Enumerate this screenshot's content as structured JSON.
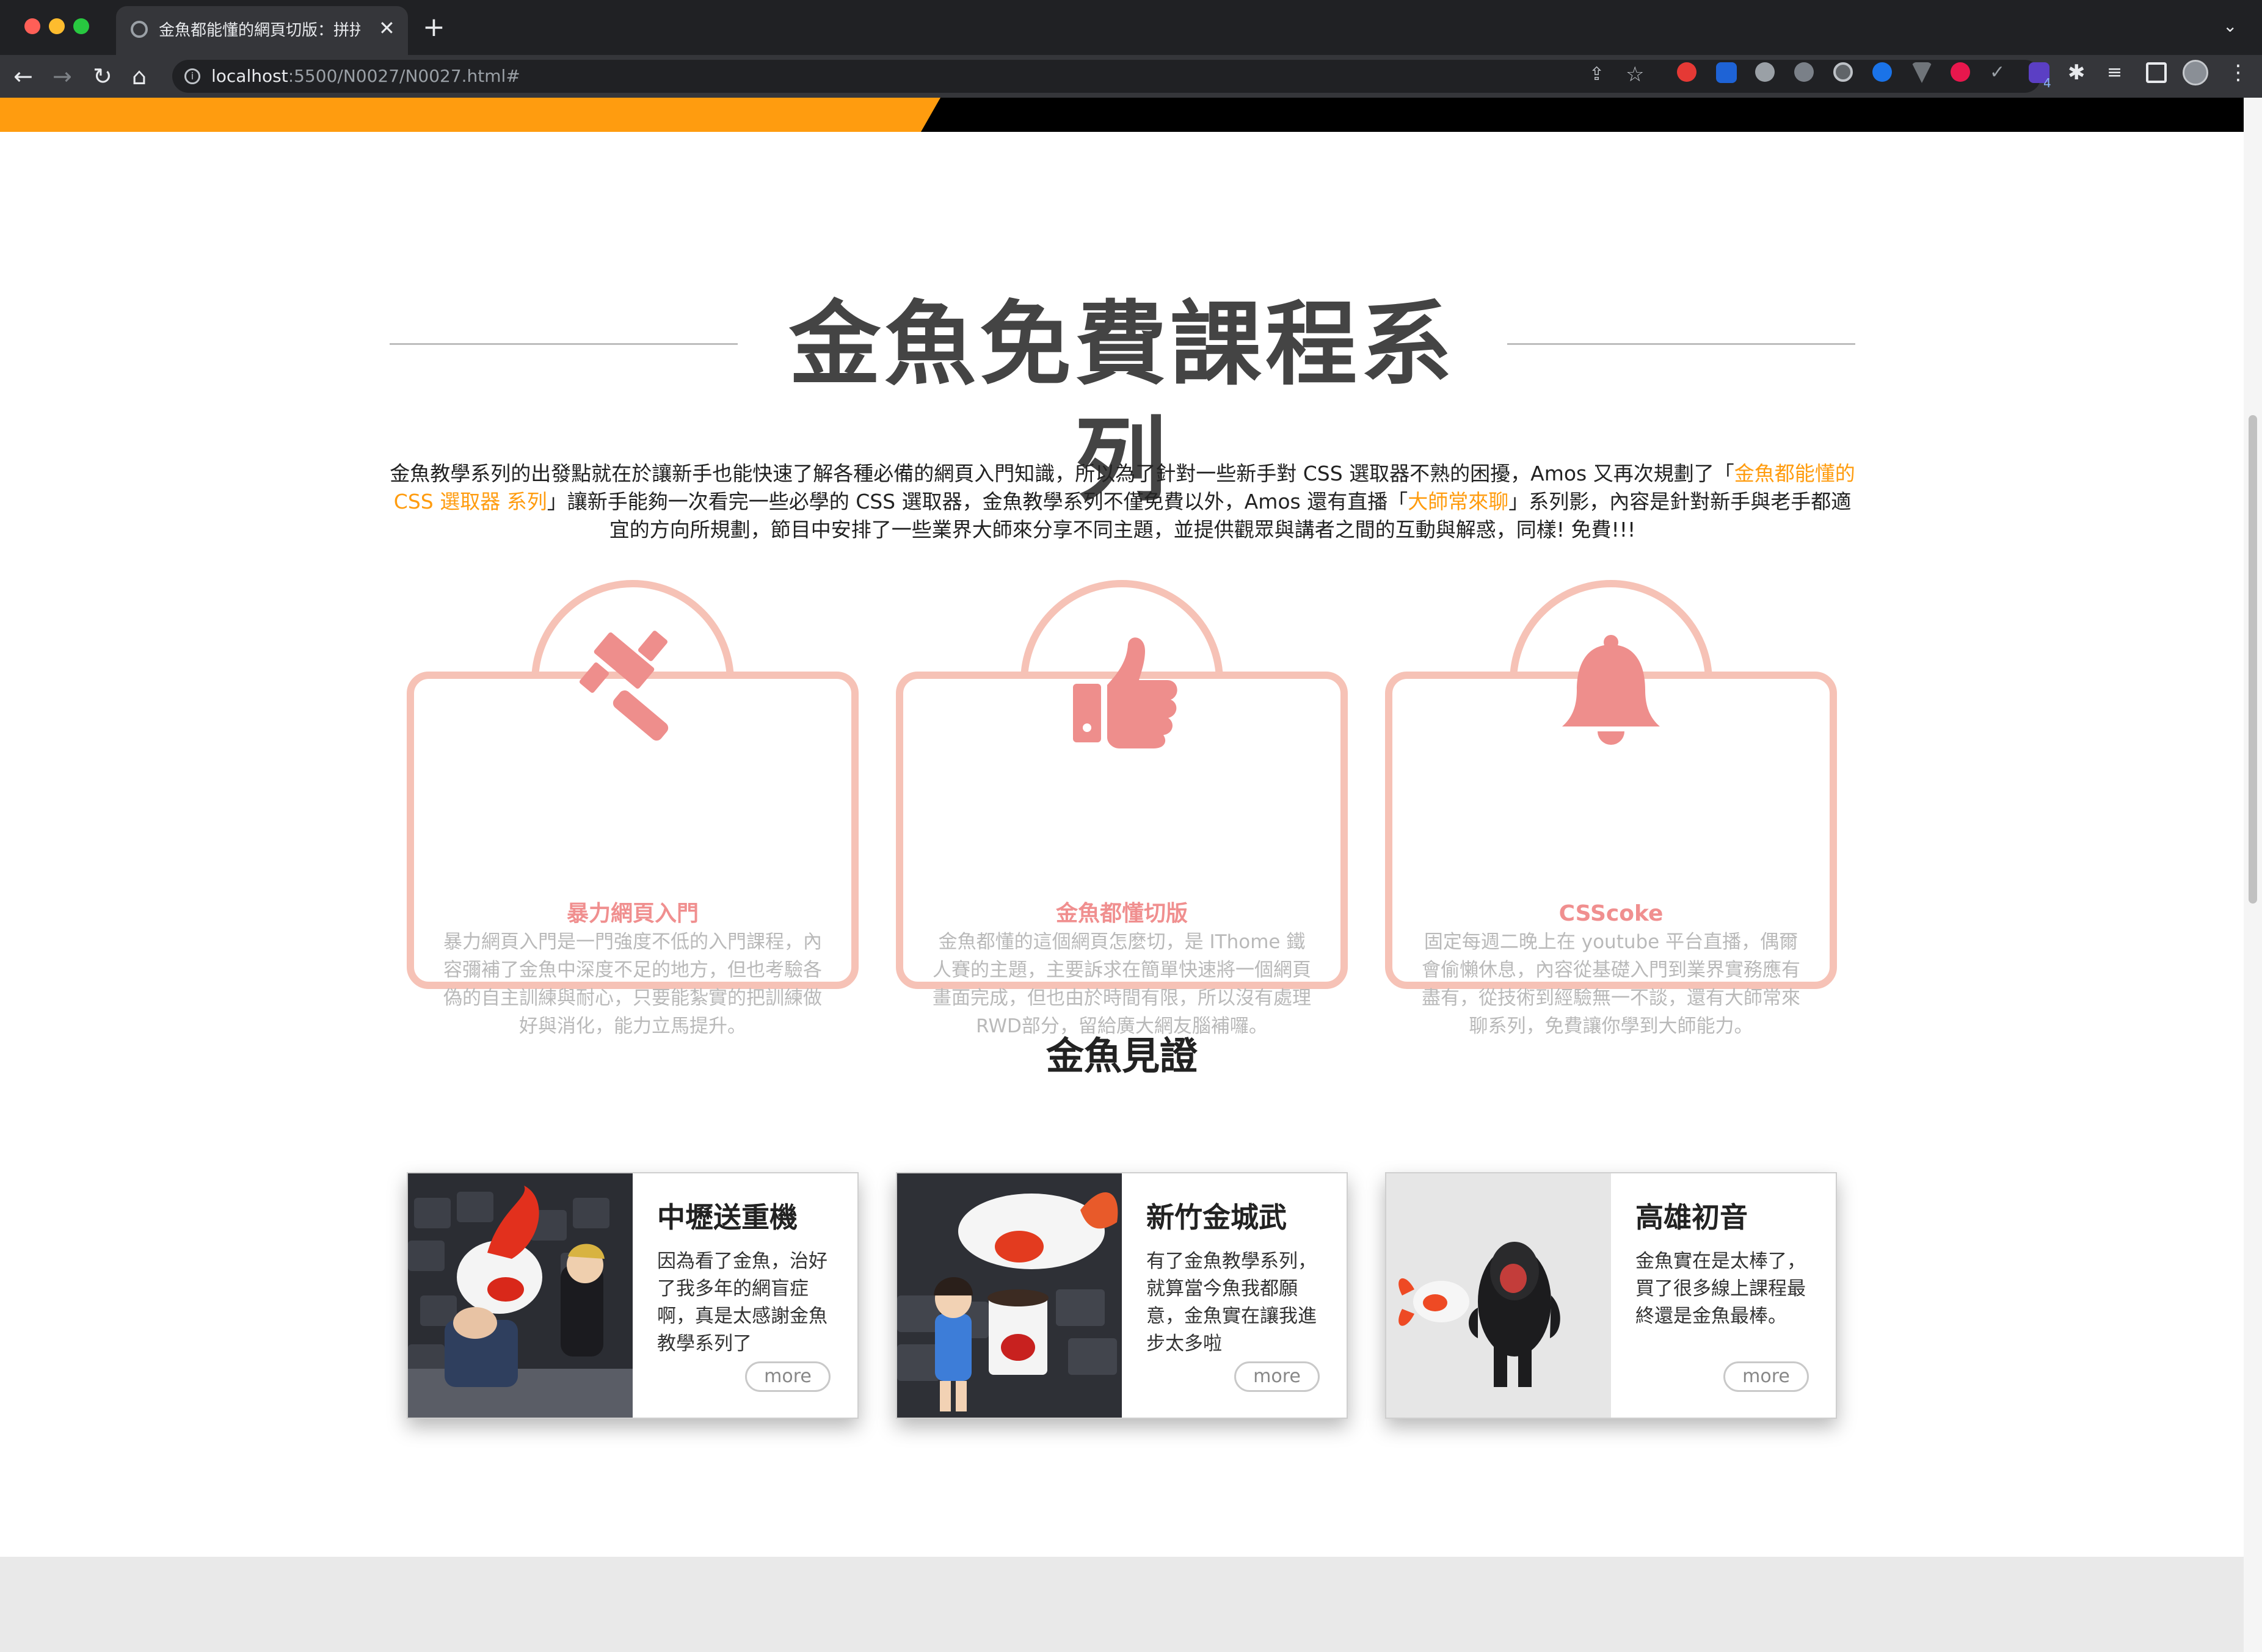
{
  "browser": {
    "tab_title": "金魚都能懂的網頁切版：拼拼版",
    "url_host": "localhost",
    "url_path": ":5500/N0027/N0027.html#",
    "extension_badge": "4"
  },
  "section": {
    "title": "金魚免費課程系列",
    "intro_part1": "金魚教學系列的出發點就在於讓新手也能快速了解各種必備的網頁入門知識，所以為了針對一些新手對 CSS 選取器不熟的困擾，Amos 又再次規劃了「",
    "intro_link1": "金魚都能懂的 CSS 選取器 系列",
    "intro_part2": "」讓新手能夠一次看完一些必學的 CSS 選取器，金魚教學系列不僅免費以外，Amos 還有直播「",
    "intro_link2": "大師常來聊",
    "intro_part3": "」系列影，內容是針對新手與老手都適宜的方向所規劃，節目中安排了一些業界大師來分享不同主題，並提供觀眾與講者之間的互動與解惑，同樣! 免費!!!"
  },
  "features": [
    {
      "icon": "gavel-icon",
      "title": "暴力網頁入門",
      "desc": "暴力網頁入門是一門強度不低的入門課程，內容彌補了金魚中深度不足的地方，但也考驗各偽的自主訓練與耐心，只要能紮實的把訓練做好與消化，能力立馬提升。"
    },
    {
      "icon": "thumbs-up-icon",
      "title": "金魚都懂切版",
      "desc": "金魚都懂的這個網頁怎麼切，是 IThome 鐵人賽的主題，主要訴求在簡單快速將一個網頁畫面完成，但也由於時間有限，所以沒有處理RWD部分，留給廣大網友腦補囉。"
    },
    {
      "icon": "bell-icon",
      "title": "CSScoke",
      "desc": "固定每週二晚上在 youtube 平台直播，偶爾會偷懶休息，內容從基礎入門到業界實務應有盡有，從技術到經驗無一不談，還有大師常來聊系列，免費讓你學到大師能力。"
    }
  ],
  "testimony": {
    "title": "金魚見證",
    "cards": [
      {
        "title": "中壢送重機",
        "text": "因為看了金魚，治好了我多年的網盲症啊，真是太感謝金魚教學系列了",
        "more": "more"
      },
      {
        "title": "新竹金城武",
        "text": "有了金魚教學系列，就算當今魚我都願意，金魚實在讓我進步太多啦",
        "more": "more"
      },
      {
        "title": "高雄初音",
        "text": "金魚實在是太棒了，買了很多線上課程最終還是金魚最棒。",
        "more": "more"
      }
    ]
  },
  "colors": {
    "accent": "#ff9c0f",
    "card_border": "#f6c2b6",
    "card_icon": "#ee8e8c",
    "card_title": "#f08f8f"
  }
}
